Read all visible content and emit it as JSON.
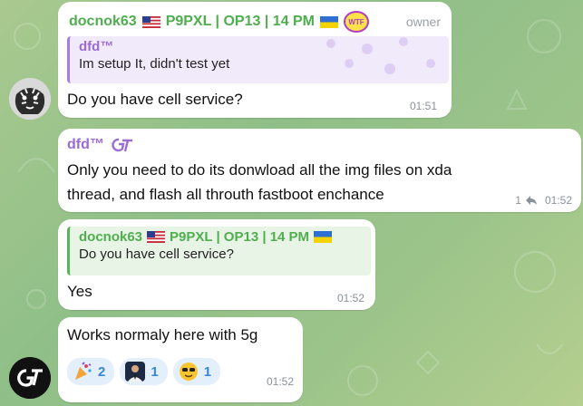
{
  "messages": [
    {
      "sender": "docnok63",
      "sender_tags": "P9PXL | OP13 | 14 PM",
      "badge": "WTF",
      "role": "owner",
      "reply": {
        "name": "dfd™",
        "text": "Im setup It, didn't test yet"
      },
      "text": "Do you have cell service?",
      "time": "01:51"
    },
    {
      "sender": "dfd™",
      "text_line1": "Only you need to do its donwload all the img files on xda",
      "text_line2": "thread, and flash all throuth fastboot enchance",
      "replies_count": "1",
      "time": "01:52"
    },
    {
      "reply": {
        "name": "docnok63",
        "tags": "P9PXL | OP13 | 14 PM",
        "text": "Do you have cell service?"
      },
      "text": "Yes",
      "time": "01:52"
    },
    {
      "text": "Works normaly here with 5g",
      "reactions": [
        {
          "emoji": "party-popper",
          "count": "2"
        },
        {
          "emoji": "person-photo",
          "count": "1"
        },
        {
          "emoji": "cool-face",
          "count": "1"
        }
      ],
      "time": "01:52"
    }
  ],
  "colors": {
    "green_name": "#4fae4e",
    "purple_name": "#9b6bd6",
    "reaction_bg": "#e3effb"
  }
}
